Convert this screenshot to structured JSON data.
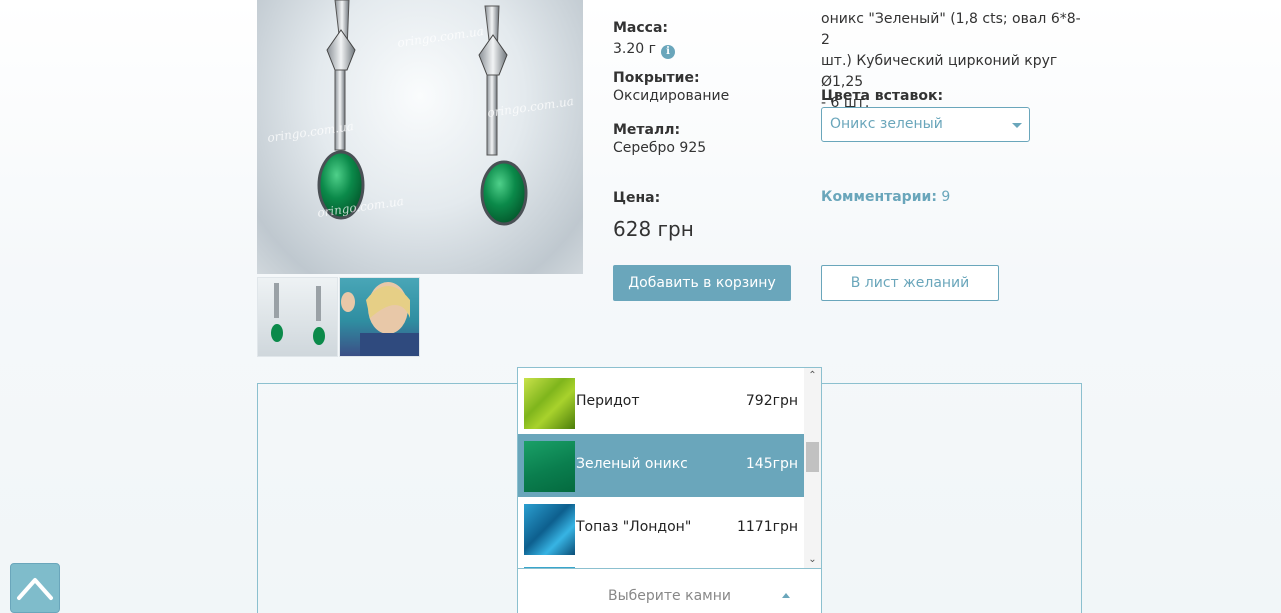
{
  "product": {
    "watermark": "oringo.com.ua"
  },
  "specs": {
    "mass_label": "Масса:",
    "mass_value": "3.20 г",
    "coating_label": "Покрытие:",
    "coating_value": "Оксидирование",
    "metal_label": "Металл:",
    "metal_value": "Серебро 925",
    "price_label": "Цена:",
    "price_value": "628 грн"
  },
  "inserts": {
    "description_line1": "оникс \"Зеленый\" (1,8 cts; овал 6*8- 2",
    "description_line2": "шт.) Кубический цирконий круг Ø1,25",
    "description_line3": "- 6 шт.",
    "colors_label": "Цвета вставок:",
    "colors_selected": "Оникс зеленый"
  },
  "comments": {
    "label": "Комментарии:",
    "count": "9"
  },
  "buttons": {
    "add_to_cart": "Добавить в корзину",
    "wishlist": "В лист желаний"
  },
  "stones": {
    "items": [
      {
        "name": "Перидот",
        "price": "792грн",
        "swatch": "peridot"
      },
      {
        "name": "Зеленый оникс",
        "price": "145грн",
        "swatch": "green-onyx",
        "selected": true
      },
      {
        "name": "Топаз \"Лондон\"",
        "price": "1171грн",
        "swatch": "london-topaz"
      }
    ],
    "placeholder": "Выберите камни"
  },
  "colors": {
    "accent": "#6aa6bb",
    "panel_border": "#8cc0cf",
    "text": "#333333"
  }
}
